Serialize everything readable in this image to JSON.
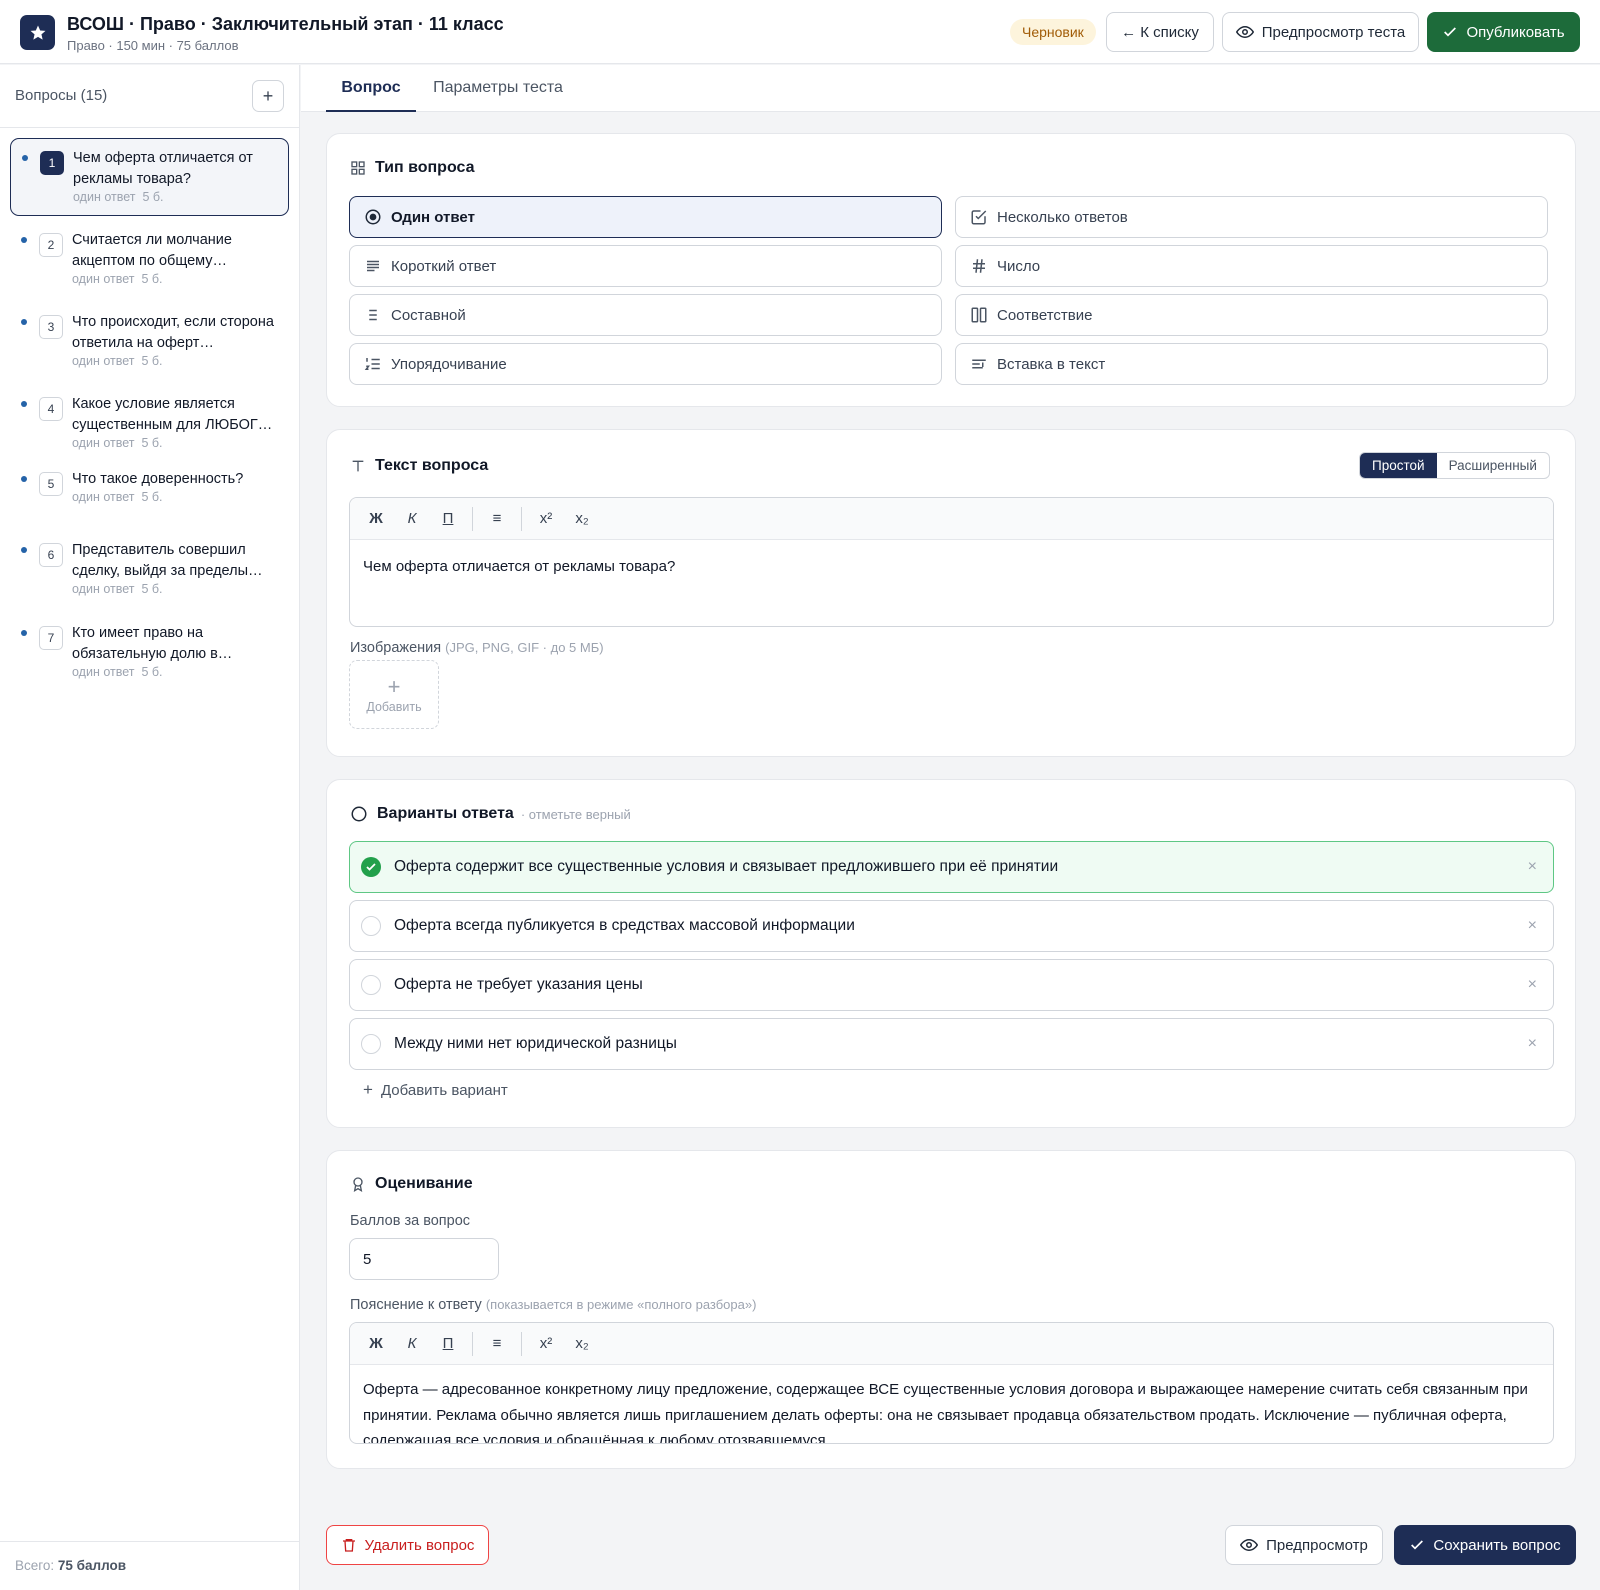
{
  "header": {
    "title": "ВСОШ · Право · Заключительный этап · 11 класс",
    "subtitle": "Право · 150 мин · 75 баллов",
    "status_badge": "Черновик",
    "back_label": "← К списку",
    "preview_test_label": "Предпросмотр теста",
    "publish_label": "Опубликовать"
  },
  "sidebar": {
    "title": "Вопросы (15)",
    "add_label": "+",
    "questions": [
      {
        "num": "1",
        "text": "Чем оферта отличается от рекламы товара?",
        "meta": "один ответ  5 б."
      },
      {
        "num": "2",
        "text": "Считается ли молчание акцептом по общему…",
        "meta": "один ответ  5 б."
      },
      {
        "num": "3",
        "text": "Что происходит, если сторона ответила на оферт…",
        "meta": "один ответ  5 б."
      },
      {
        "num": "4",
        "text": "Какое условие является существенным для ЛЮБОГ…",
        "meta": "один ответ  5 б."
      },
      {
        "num": "5",
        "text": "Что такое доверенность?",
        "meta": "один ответ  5 б."
      },
      {
        "num": "6",
        "text": "Представитель совершил сделку, выйдя за пределы…",
        "meta": "один ответ  5 б."
      },
      {
        "num": "7",
        "text": "Кто имеет право на обязательную долю в…",
        "meta": "один ответ  5 б."
      }
    ],
    "total_prefix": "Всего: ",
    "total_value": "75 баллов"
  },
  "tabs": [
    "Вопрос",
    "Параметры теста"
  ],
  "question_type": {
    "title": "Тип вопроса",
    "options": [
      "Один ответ",
      "Несколько ответов",
      "Короткий ответ",
      "Число",
      "Составной",
      "Соответствие",
      "Упорядочивание",
      "Вставка в текст"
    ]
  },
  "question_text": {
    "title": "Текст вопроса",
    "mode_simple": "Простой",
    "mode_extended": "Расширенный",
    "toolbar": [
      "Ж",
      "К",
      "П",
      "≡",
      "x²",
      "x₂"
    ],
    "content": "Чем оферта отличается от рекламы товара?",
    "images_label": "Изображения",
    "images_hint": "(JPG, PNG, GIF · до 5 МБ)",
    "add_image_label": "Добавить"
  },
  "answers": {
    "title": "Варианты ответа",
    "hint": "· отметьте верный",
    "options": [
      {
        "text": "Оферта содержит все существенные условия и связывает предложившего при её принятии"
      },
      {
        "text": "Оферта всегда публикуется в средствах массовой информации"
      },
      {
        "text": "Оферта не требует указания цены"
      },
      {
        "text": "Между ними нет юридической разницы"
      }
    ],
    "add_option_label": "Добавить вариант"
  },
  "grading": {
    "title": "Оценивание",
    "points_label": "Баллов за вопрос",
    "points_value": "5",
    "explanation_label": "Пояснение к ответу",
    "explanation_hint": "(показывается в режиме «полного разбора»)",
    "explanation_text": "Оферта — адресованное конкретному лицу предложение, содержащее ВСЕ существенные условия договора и выражающее намерение считать себя связанным при принятии. Реклама обычно является лишь приглашением делать оферты: она не связывает продавца обязательством продать. Исключение — публичная оферта, содержащая все условия и обращённая к любому отозвавшемуся."
  },
  "footer": {
    "delete_label": "Удалить вопрос",
    "preview_label": "Предпросмотр",
    "save_label": "Сохранить вопрос"
  },
  "colors": {
    "navy": "#1e2d55",
    "green": "#1d6b3a",
    "correct": "#22a04b",
    "danger": "#c81e1e",
    "draft": "#a15c07"
  }
}
